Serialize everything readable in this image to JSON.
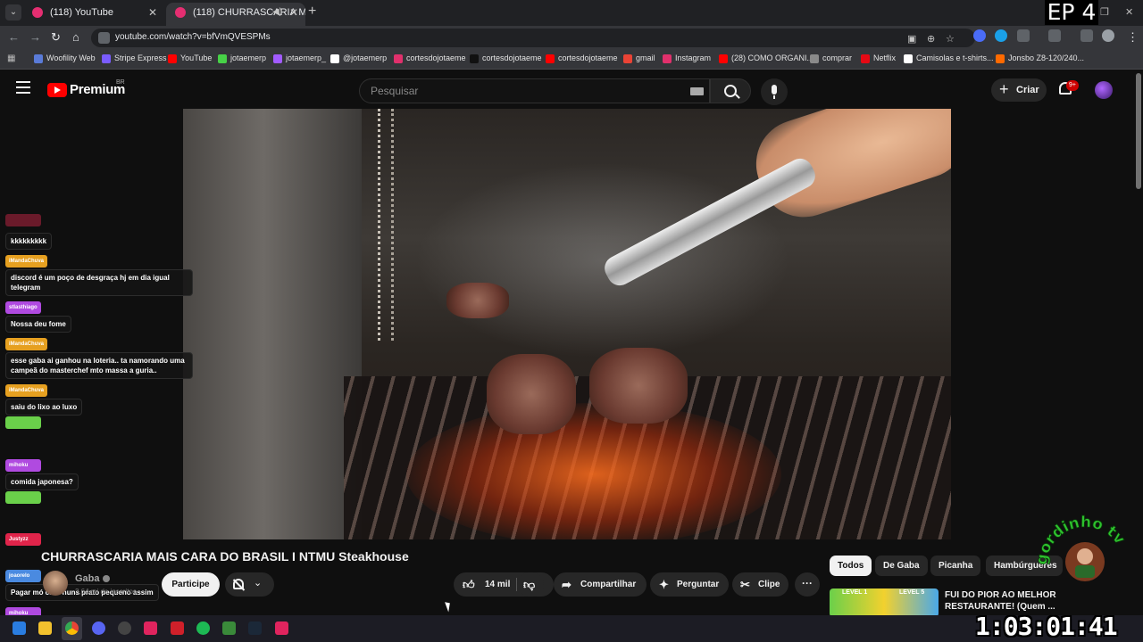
{
  "browser": {
    "tabs": [
      {
        "title": "(118) YouTube",
        "active": false
      },
      {
        "title": "(118) CHURRASCARIA MAIS",
        "active": true
      }
    ],
    "url": "youtube.com/watch?v=bfVmQVESPMs",
    "bookmarks": [
      {
        "label": "Woofility Web",
        "color": "#5a7bd8"
      },
      {
        "label": "Stripe Express",
        "color": "#7a5cff"
      },
      {
        "label": "YouTube",
        "color": "#ff0000"
      },
      {
        "label": "jotaemerp",
        "color": "#47d147"
      },
      {
        "label": "jotaemerp_",
        "color": "#a25bff"
      },
      {
        "label": "@jotaemerp",
        "color": "#ffffff"
      },
      {
        "label": "cortesdojotaeme",
        "color": "#e1306c"
      },
      {
        "label": "cortesdojotaeme",
        "color": "#111111"
      },
      {
        "label": "cortesdojotaeme",
        "color": "#ff0000"
      },
      {
        "label": "gmail",
        "color": "#ea4335"
      },
      {
        "label": "Instagram",
        "color": "#e1306c"
      },
      {
        "label": "(28) COMO ORGANI...",
        "color": "#ff0000"
      },
      {
        "label": "comprar",
        "color": "#8a8a8a"
      },
      {
        "label": "Netflix",
        "color": "#e50914"
      },
      {
        "label": "Camisolas e t-shirts...",
        "color": "#ffffff"
      },
      {
        "label": "Jonsbo Z8-120/240...",
        "color": "#ff6a00"
      }
    ],
    "overlay_episode": "EP 4"
  },
  "header": {
    "brand": "Premium",
    "region": "BR",
    "search_placeholder": "Pesquisar",
    "create_label": "Criar",
    "notification_count": "9+"
  },
  "chat": [
    {
      "user": "",
      "text": "kkkkkkkkk",
      "color": "#6a1a2a"
    },
    {
      "user": "iMandaChuva",
      "text": "discord é um poço de desgraça hj em dia igual telegram",
      "color": "#e6a020"
    },
    {
      "user": "stlasthiago",
      "text": "Nossa deu fome",
      "color": "#b04ae0"
    },
    {
      "user": "iMandaChuva",
      "text": "esse gaba ai ganhou na loteria.. ta namorando uma campeã do masterchef mto massa a guria..",
      "color": "#e6a020"
    },
    {
      "user": "iMandaChuva",
      "text": "saiu do lixo ao luxo",
      "color": "#e6a020"
    },
    {
      "user": "",
      "text": "",
      "color": "#6ad04a"
    },
    {
      "user": "mihoku",
      "text": "comida japonesa?",
      "color": "#b04ae0"
    },
    {
      "user": "",
      "text": "",
      "color": "#6ad04a"
    },
    {
      "user": "Justyzz",
      "text": "",
      "color": "#e0244a"
    },
    {
      "user": "joaorelo",
      "text": "Pagar mó caro nuns prato pequeno assim",
      "color": "#4a8ae0"
    },
    {
      "user": "mihoku",
      "text": "",
      "color": "#b04ae0"
    }
  ],
  "video": {
    "title": "CHURRASCARIA MAIS CARA DO BRASIL I NTMU Steakhouse",
    "channel": "Gaba",
    "subscribers": "2,64 mi de inscritos",
    "join_label": "Participe",
    "likes": "14 mil",
    "share_label": "Compartilhar",
    "ask_label": "Perguntar",
    "clip_label": "Clipe"
  },
  "chips": [
    {
      "label": "Todos",
      "active": true
    },
    {
      "label": "De Gaba",
      "active": false
    },
    {
      "label": "Picanha",
      "active": false
    },
    {
      "label": "Hambúrgueres",
      "active": false
    }
  ],
  "recommendation": {
    "title": "FUI DO PIOR AO MELHOR RESTAURANTE! (Quem ...",
    "thumb_labels": [
      "LEVEL 1",
      "LEVEL 5"
    ]
  },
  "stream_timer": "1:03:01:41",
  "badge_text": "gordinho tv"
}
